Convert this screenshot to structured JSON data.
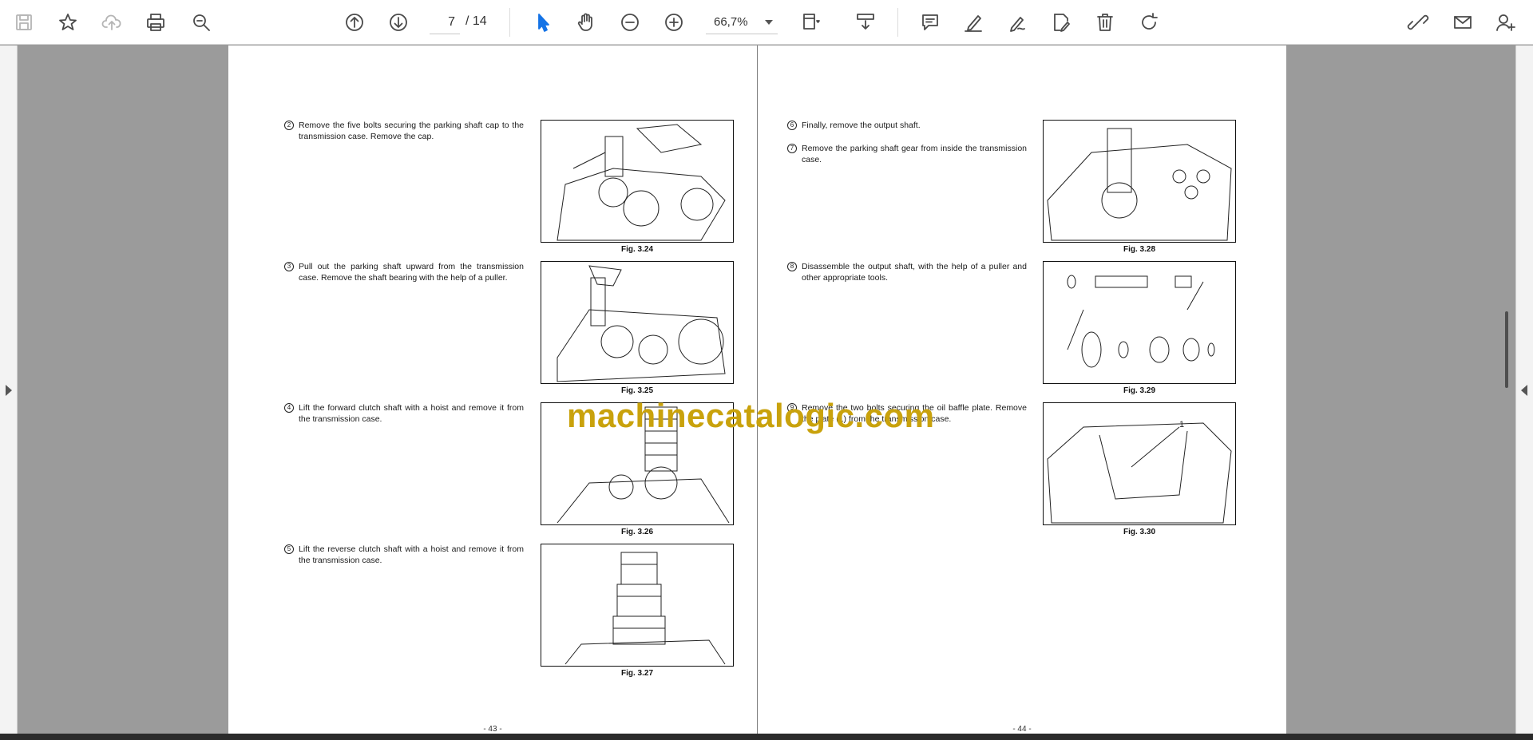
{
  "toolbar": {
    "current_page": "7",
    "page_total": "/  14",
    "zoom_level": "66,7%"
  },
  "left_page": {
    "page_number": "- 43 -",
    "steps": [
      {
        "num": "2",
        "text": "Remove the five bolts securing the parking shaft cap to the transmission case. Remove the cap.",
        "fig": "Fig. 3.24"
      },
      {
        "num": "3",
        "text": "Pull out the parking shaft upward from the transmission case. Remove the shaft bearing with the help of a puller.",
        "fig": "Fig. 3.25"
      },
      {
        "num": "4",
        "text": "Lift the forward clutch shaft with a hoist and remove it from the transmission case.",
        "fig": "Fig. 3.26"
      },
      {
        "num": "5",
        "text": "Lift the reverse clutch shaft with a hoist and remove it from the transmission case.",
        "fig": "Fig. 3.27"
      }
    ]
  },
  "right_page": {
    "page_number": "- 44 -",
    "steps": [
      {
        "num": "6",
        "text": "Finally, remove the output shaft."
      },
      {
        "num": "7",
        "text": "Remove the parking shaft gear from inside the transmission case.",
        "fig": "Fig. 3.28"
      },
      {
        "num": "8",
        "text": "Disassemble the output shaft, with the help of a puller and other appropriate tools.",
        "fig": "Fig. 3.29"
      },
      {
        "num": "9",
        "text": "Remove the two bolts securing the oil baffle plate. Remove the plate (1) from the transmission case.",
        "fig": "Fig. 3.30"
      }
    ],
    "fig330_callout": "1"
  },
  "watermark": "machinecatalogic.com",
  "icons": [
    "save-icon",
    "bookmark-star-icon",
    "upload-cloud-icon",
    "print-icon",
    "zoom-search-icon",
    "page-up-icon",
    "page-down-icon",
    "select-cursor-icon",
    "hand-tool-icon",
    "zoom-out-icon",
    "zoom-in-icon",
    "fit-page-icon",
    "scroll-mode-icon",
    "comment-icon",
    "highlight-pen-icon",
    "draw-icon",
    "fill-sign-icon",
    "delete-icon",
    "rotate-icon",
    "share-link-icon",
    "email-icon",
    "add-user-icon"
  ]
}
